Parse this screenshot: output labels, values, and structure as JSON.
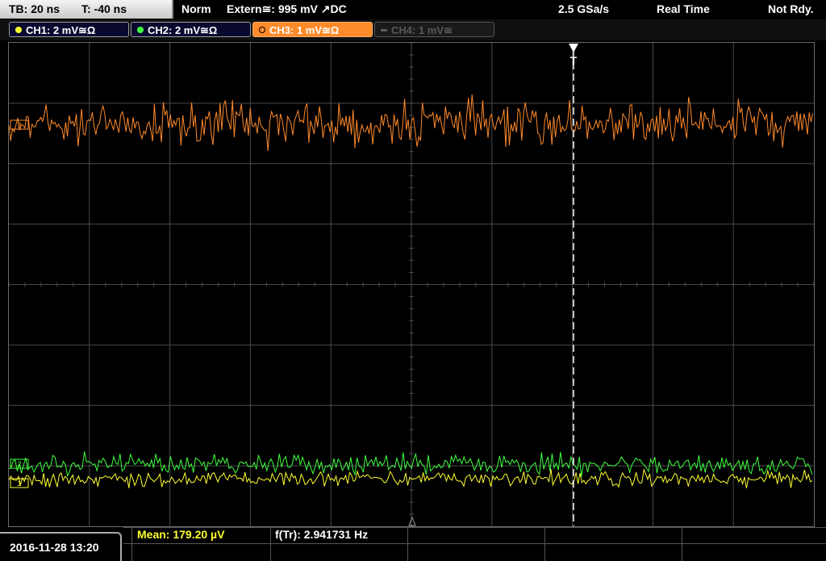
{
  "timebase": {
    "tb_label": "TB: 20 ns",
    "t_label": "T: -40 ns"
  },
  "status": {
    "mode": "Norm",
    "trigger": "Extern≅: 995 mV ↗DC",
    "sample_rate": "2.5 GSa/s",
    "acquisition": "Real Time",
    "state": "Not Rdy."
  },
  "channels": [
    {
      "label": "CH1: 2 mV≅Ω",
      "color": "#ffff30",
      "state": "on"
    },
    {
      "label": "CH2: 2 mV≅Ω",
      "color": "#40ff40",
      "state": "on"
    },
    {
      "label": "CH3: 1 mV≅Ω",
      "color": "#ff8a2a",
      "state": "selected"
    },
    {
      "label": "CH4: 1 mV≅",
      "color": "#5a5a5a",
      "state": "off"
    }
  ],
  "markers": {
    "ch3": "3",
    "ch2": "2",
    "ch1": "1",
    "trigger": "T"
  },
  "datetime": "2016-11-28 13:20",
  "measurements": {
    "mean": "Mean: 179.20 µV",
    "freq": "f(Tr): 2.941731 Hz"
  },
  "colors": {
    "ch1": "#ffff30",
    "ch2": "#40ff40",
    "ch3": "#ff8a2a",
    "grid": "#4a4a4a"
  }
}
